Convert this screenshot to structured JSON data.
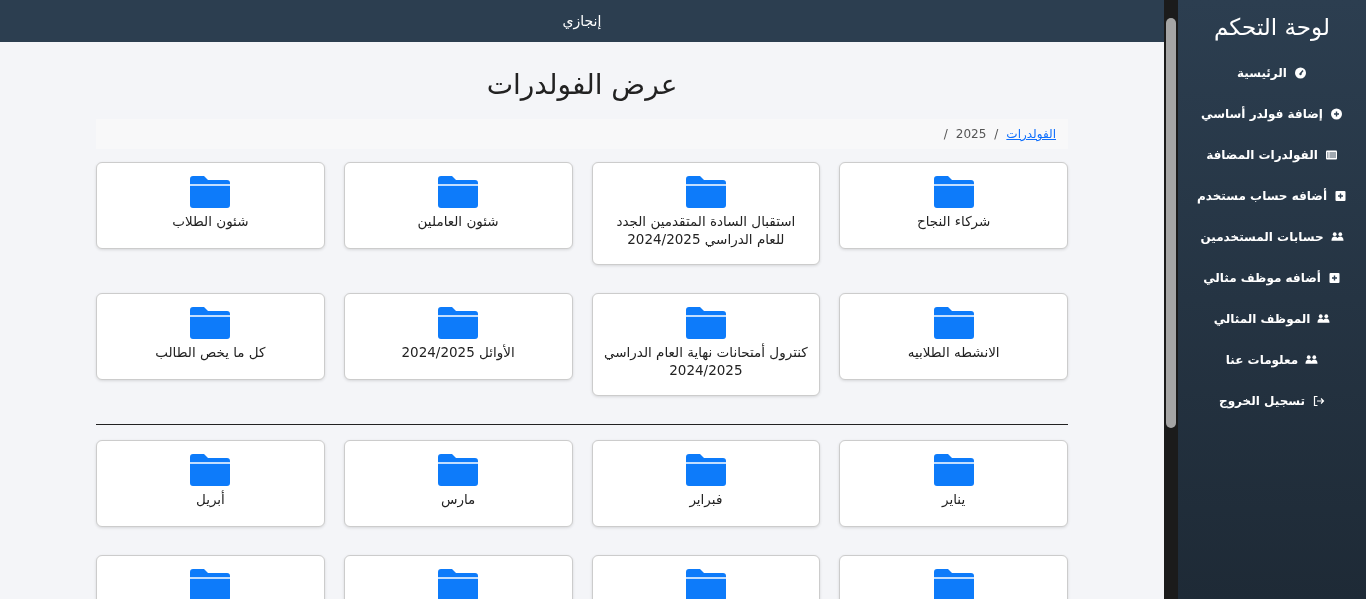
{
  "top_bar": {
    "title": "إنجازي"
  },
  "page_title": "عرض الفولدرات",
  "breadcrumb": [
    {
      "label": "الفولدرات",
      "link": true,
      "separator": "/"
    },
    {
      "label": "2025",
      "link": false,
      "separator": "/"
    }
  ],
  "folder_groups": [
    {
      "rows": [
        [
          {
            "label": "شركاء النجاح"
          },
          {
            "label": "استقبال السادة المتقدمين الجدد للعام الدراسي 2024/2025"
          },
          {
            "label": "شئون العاملين"
          },
          {
            "label": "شئون الطلاب"
          }
        ],
        [
          {
            "label": "الانشطه الطلابيه"
          },
          {
            "label": "كنترول أمتحانات نهاية العام الدراسي 2024/2025"
          },
          {
            "label": "الأوائل 2024/2025"
          },
          {
            "label": "كل ما يخص الطالب"
          }
        ]
      ]
    },
    {
      "rows": [
        [
          {
            "label": "يناير"
          },
          {
            "label": "فبراير"
          },
          {
            "label": "مارس"
          },
          {
            "label": "أبريل"
          }
        ],
        [
          {},
          {},
          {},
          {}
        ]
      ]
    }
  ],
  "sidebar": {
    "title": "لوحة التحكم",
    "items": [
      {
        "label": "الرئيسية",
        "kind": "dashboard"
      },
      {
        "label": "إضافة فولدر أساسي",
        "kind": "add-circle"
      },
      {
        "label": "الفولدرات المضافة",
        "kind": "list"
      },
      {
        "label": "أضافه حساب مستخدم",
        "kind": "add-box"
      },
      {
        "label": "حسابات المستخدمين",
        "kind": "users"
      },
      {
        "label": "أضافه موظف مثالي",
        "kind": "add-box"
      },
      {
        "label": "الموظف المثالي",
        "kind": "users"
      },
      {
        "label": "معلومات عنا",
        "kind": "users"
      },
      {
        "label": "تسجيل الخروج",
        "kind": "logout"
      }
    ]
  }
}
